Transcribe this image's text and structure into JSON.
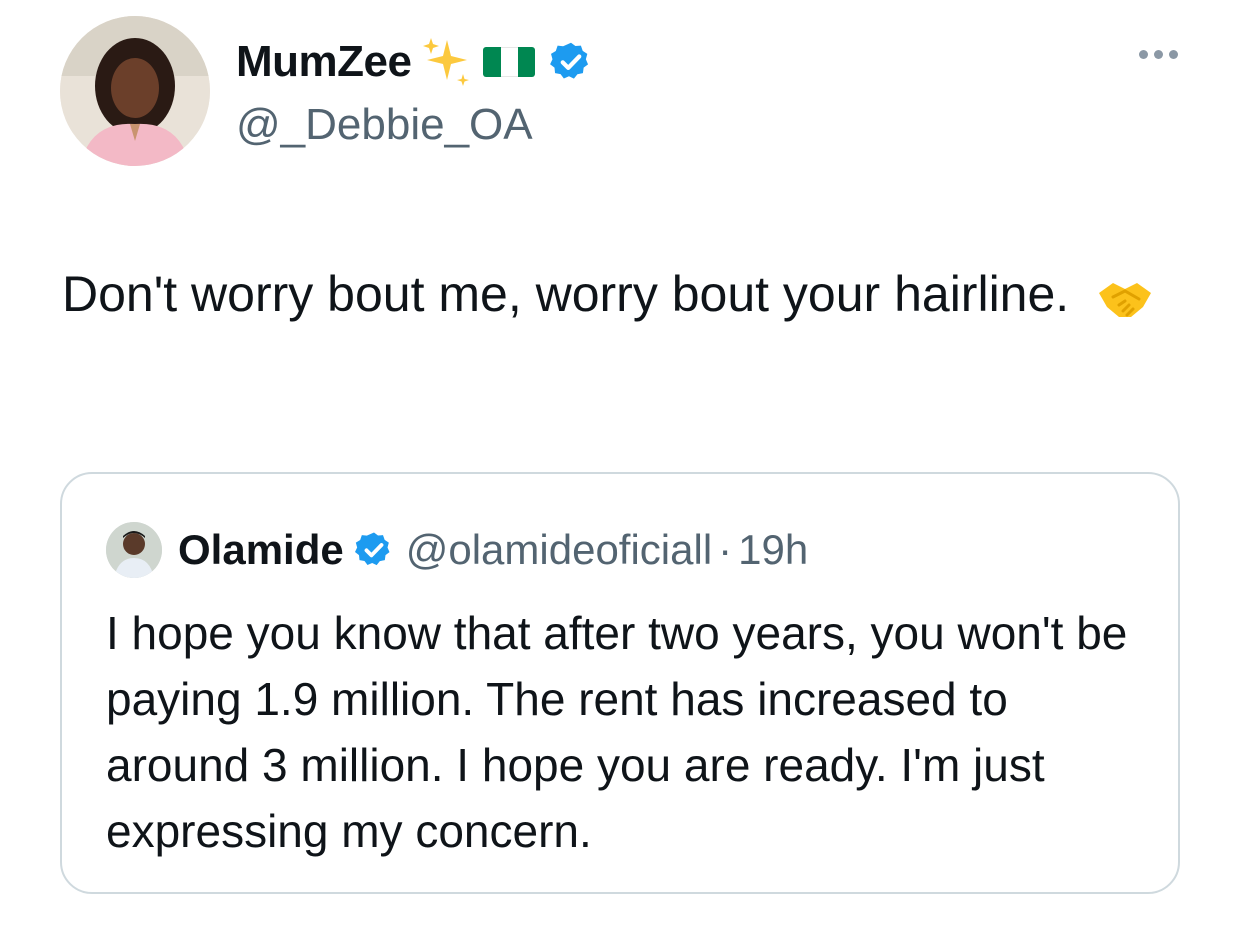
{
  "author": {
    "display_name": "MumZee",
    "handle": "@_Debbie_OA"
  },
  "tweet": {
    "text": "Don't worry bout me, worry bout your hairline."
  },
  "quoted": {
    "display_name": "Olamide",
    "handle": "@olamideoficiall",
    "separator": "·",
    "time": "19h",
    "text": "I hope you know that after two years, you won't be paying 1.9 million. The rent has increased to around 3 million. I hope you are ready. I'm just expressing my concern."
  },
  "icons": {
    "sparkles": "sparkles-icon",
    "flag": "nigeria-flag-icon",
    "verified": "verified-badge-icon",
    "more": "more-options-icon",
    "emoji": "handshake-icon"
  },
  "colors": {
    "verified": "#1d9bf0",
    "flag_green": "#008751",
    "secondary_text": "#536471",
    "border": "#cfd9de"
  }
}
